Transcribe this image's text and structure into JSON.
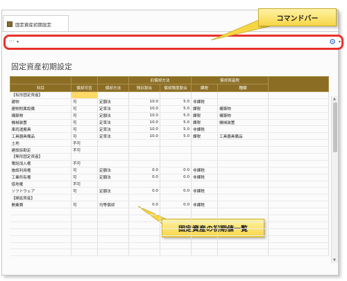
{
  "tab": {
    "title": "固定資産初期設定"
  },
  "command_bar": {
    "more_label": "···",
    "caret": "▾",
    "gear_icon": "gear-icon"
  },
  "callouts": {
    "command_bar": "コマンドバー",
    "list": "固定資産の初期値一覧"
  },
  "page_title": "固定資産初期設定",
  "table": {
    "group_headers": {
      "old_method": "旧償却方法",
      "depreciable_tax": "償却資産税"
    },
    "columns": [
      "科目",
      "償却可否",
      "償却方法",
      "残存割合",
      "償却限度割合",
      "課税",
      "種類"
    ],
    "rows": [
      {
        "type": "section",
        "cells": [
          "【有形固定資産】",
          "",
          "",
          "",
          "",
          "",
          ""
        ]
      },
      {
        "type": "data",
        "cells": [
          "建物",
          "可",
          "定額法",
          "10.0",
          "5.0",
          "非課税",
          ""
        ]
      },
      {
        "type": "data",
        "cells": [
          "建物附属設備",
          "可",
          "定率法",
          "10.0",
          "5.0",
          "課税",
          "構築物"
        ]
      },
      {
        "type": "data",
        "cells": [
          "構築物",
          "可",
          "定額法",
          "10.0",
          "5.0",
          "課税",
          "構築物"
        ]
      },
      {
        "type": "data",
        "cells": [
          "機械装置",
          "可",
          "定率法",
          "10.0",
          "5.0",
          "課税",
          "機械装置"
        ]
      },
      {
        "type": "data",
        "cells": [
          "車両運搬具",
          "可",
          "定率法",
          "10.0",
          "5.0",
          "非課税",
          ""
        ]
      },
      {
        "type": "data",
        "cells": [
          "工具器具備品",
          "可",
          "定率法",
          "10.0",
          "5.0",
          "課税",
          "工具器具備品"
        ]
      },
      {
        "type": "data",
        "cells": [
          "土地",
          "不可",
          "",
          "",
          "",
          "",
          ""
        ]
      },
      {
        "type": "data",
        "cells": [
          "建設仮勘定",
          "不可",
          "",
          "",
          "",
          "",
          ""
        ]
      },
      {
        "type": "section",
        "cells": [
          "【無形固定資産】",
          "",
          "",
          "",
          "",
          "",
          ""
        ]
      },
      {
        "type": "data",
        "cells": [
          "電話加入権",
          "不可",
          "",
          "",
          "",
          "",
          ""
        ]
      },
      {
        "type": "data",
        "cells": [
          "施設利用権",
          "可",
          "定額法",
          "0.0",
          "0.0",
          "非課税",
          ""
        ]
      },
      {
        "type": "data",
        "cells": [
          "工業所有権",
          "可",
          "定額法",
          "0.0",
          "0.0",
          "非課税",
          ""
        ]
      },
      {
        "type": "data",
        "cells": [
          "借地権",
          "不可",
          "",
          "",
          "",
          "",
          ""
        ]
      },
      {
        "type": "data",
        "cells": [
          "ソフトウェア",
          "可",
          "定額法",
          "0.0",
          "0.0",
          "非課税",
          ""
        ]
      },
      {
        "type": "section",
        "cells": [
          "【繰延資産】",
          "",
          "",
          "",
          "",
          "",
          ""
        ]
      },
      {
        "type": "data",
        "cells": [
          "開業費",
          "可",
          "均等償却",
          "0.0",
          "0.0",
          "非課税",
          ""
        ]
      },
      {
        "type": "empty",
        "cells": [
          "",
          "",
          "",
          "",
          "",
          "",
          ""
        ]
      },
      {
        "type": "empty",
        "cells": [
          "",
          "",
          "",
          "",
          "",
          "",
          ""
        ]
      },
      {
        "type": "empty",
        "cells": [
          "",
          "",
          "",
          "",
          "",
          "",
          ""
        ]
      },
      {
        "type": "empty",
        "cells": [
          "",
          "",
          "",
          "",
          "",
          "",
          ""
        ]
      },
      {
        "type": "empty",
        "cells": [
          "",
          "",
          "",
          "",
          "",
          "",
          ""
        ]
      },
      {
        "type": "empty",
        "cells": [
          "",
          "",
          "",
          "",
          "",
          "",
          ""
        ]
      },
      {
        "type": "empty",
        "cells": [
          "",
          "",
          "",
          "",
          "",
          "",
          ""
        ]
      }
    ]
  },
  "colors": {
    "header": "#8b6d24",
    "highlight": "#ffd966",
    "command_bar_border": "#e8302a",
    "callout": "#f7d646"
  }
}
